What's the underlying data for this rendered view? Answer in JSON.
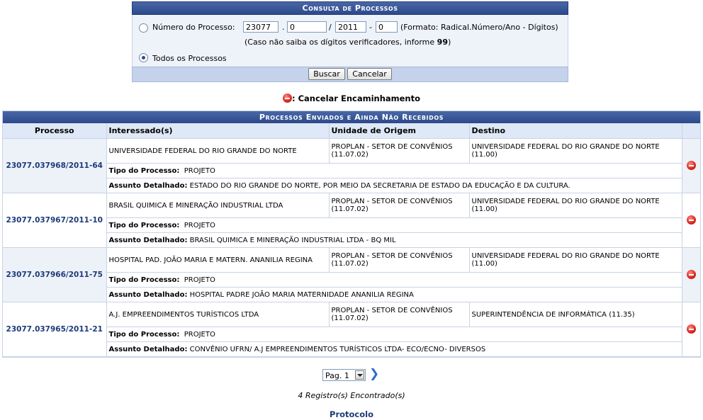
{
  "consulta": {
    "title": "Consulta de Processos",
    "numero_label": "Número do Processo:",
    "radical": "23077",
    "numero": "0",
    "ano": "2011",
    "digitos": "0",
    "sep_dot": ".",
    "sep_slash": "/",
    "sep_dash": "-",
    "formato_hint": "(Formato: Radical.Número/Ano - Dígitos)",
    "verificadores_hint_prefix": "(Caso não saiba os dígitos verificadores, informe ",
    "verificadores_hint_value": "99",
    "verificadores_hint_suffix": ")",
    "todos_label": "Todos os Processos",
    "buscar_label": "Buscar",
    "cancelar_label": "Cancelar",
    "selected": "todos"
  },
  "legend": {
    "text": ": Cancelar Encaminhamento"
  },
  "table": {
    "title": "Processos Enviados e Ainda Não Recebidos",
    "headers": [
      "Processo",
      "Interessado(s)",
      "Unidade de Origem",
      "Destino"
    ],
    "tipo_label": "Tipo do Processo:",
    "assunto_label": "Assunto Detalhado:",
    "rows": [
      {
        "processo": "23077.037968/2011-64",
        "interessado": "UNIVERSIDADE FEDERAL DO RIO GRANDE DO NORTE",
        "origem": "PROPLAN - SETOR DE CONVÊNIOS (11.07.02)",
        "destino": "UNIVERSIDADE FEDERAL DO RIO GRANDE DO NORTE (11.00)",
        "tipo": "PROJETO",
        "assunto": "ESTADO DO RIO GRANDE DO NORTE, POR MEIO DA SECRETARIA DE ESTADO DA EDUCAÇÃO E DA CULTURA."
      },
      {
        "processo": "23077.037967/2011-10",
        "interessado": "BRASIL QUIMICA E MINERAÇÃO INDUSTRIAL LTDA",
        "origem": "PROPLAN - SETOR DE CONVÊNIOS (11.07.02)",
        "destino": "UNIVERSIDADE FEDERAL DO RIO GRANDE DO NORTE (11.00)",
        "tipo": "PROJETO",
        "assunto": "BRASIL QUIMICA E MINERAÇÃO INDUSTRIAL LTDA - BQ MIL"
      },
      {
        "processo": "23077.037966/2011-75",
        "interessado": "HOSPITAL PAD. JOÃO MARIA E MATERN. ANANILIA REGINA",
        "origem": "PROPLAN - SETOR DE CONVÊNIOS (11.07.02)",
        "destino": "UNIVERSIDADE FEDERAL DO RIO GRANDE DO NORTE (11.00)",
        "tipo": "PROJETO",
        "assunto": "HOSPITAL PADRE JOÃO MARIA MATERNIDADE ANANILIA REGINA"
      },
      {
        "processo": "23077.037965/2011-21",
        "interessado": "A.J. EMPREENDIMENTOS TURÍSTICOS LTDA",
        "origem": "PROPLAN - SETOR DE CONVÊNIOS (11.07.02)",
        "destino": "SUPERINTENDÊNCIA DE INFORMÁTICA (11.35)",
        "tipo": "PROJETO",
        "assunto": "CONVÊNIO UFRN/ A.J EMPREENDIMENTOS TURÍSTICOS LTDA- ECO/ECNO- DIVERSOS"
      }
    ]
  },
  "pager": {
    "page_label": "Pag. 1"
  },
  "count_text": "4 Registro(s) Encontrado(s)",
  "footer_link": "Protocolo",
  "icons": {
    "cancel": "cancel-icon",
    "next": "next-arrow-icon",
    "dropdown": "chevron-down-icon"
  },
  "colors": {
    "header_bg": "#2c4a8a",
    "link": "#1c3a7a",
    "cancel": "#d8231a"
  }
}
